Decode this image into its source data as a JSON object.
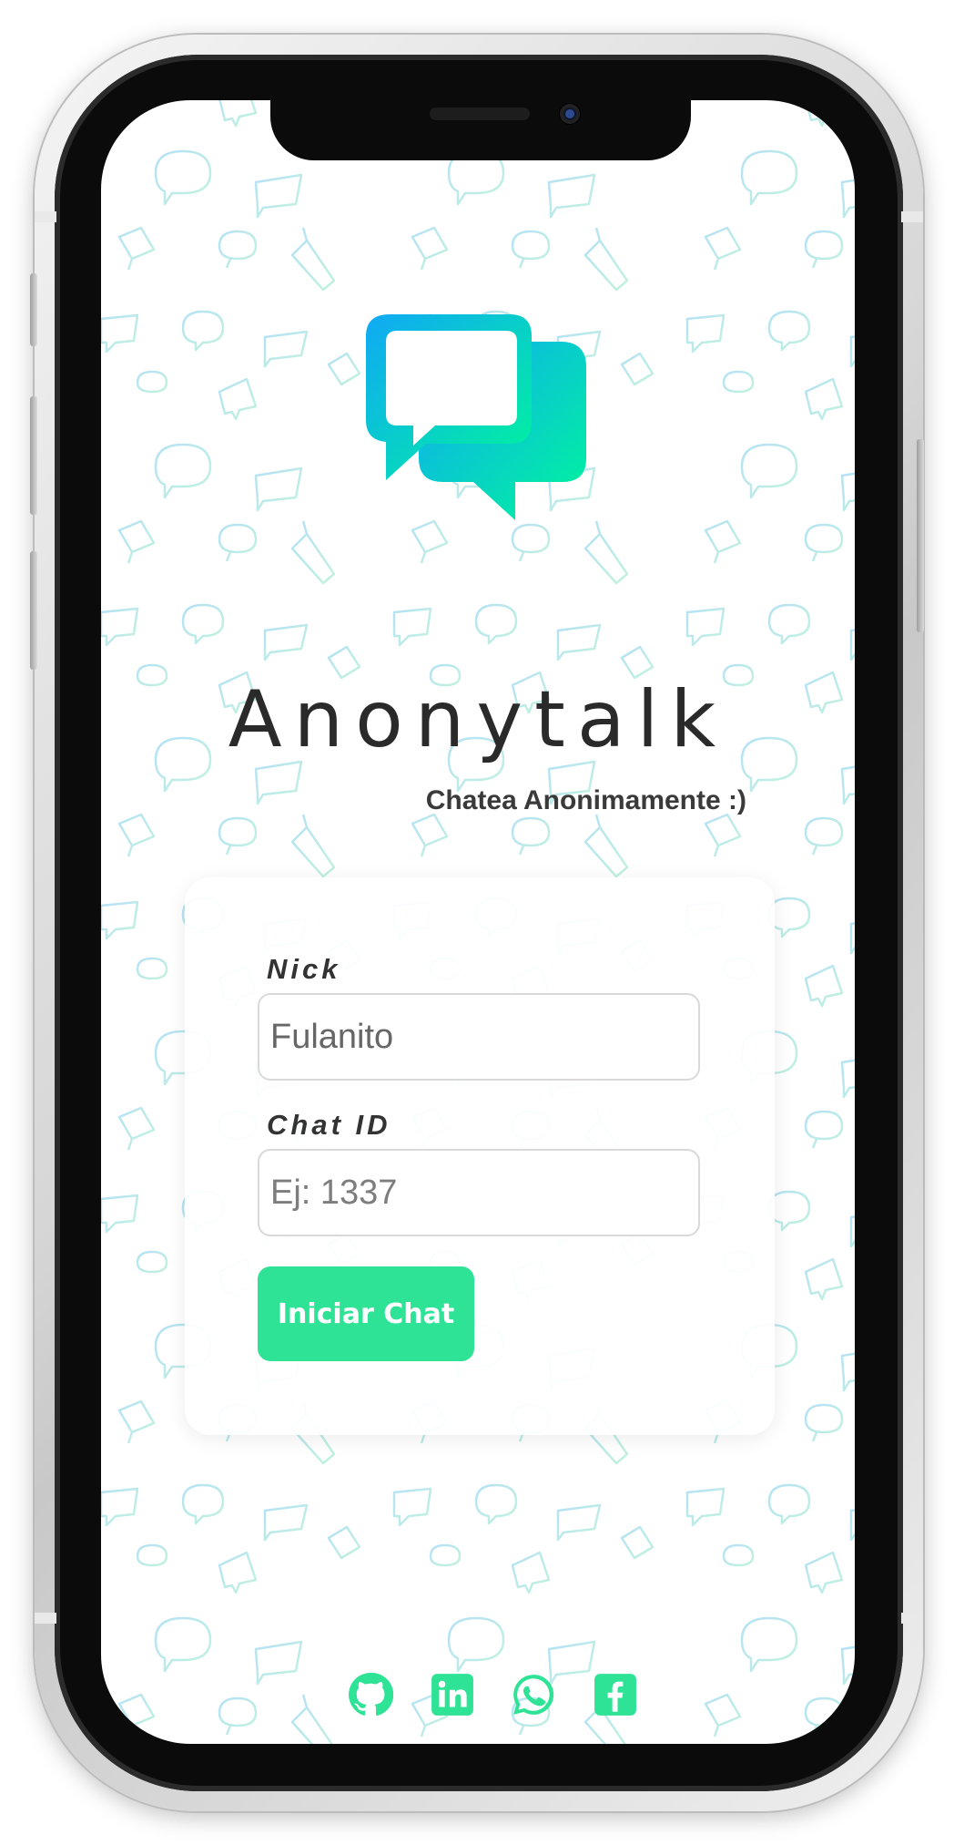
{
  "app": {
    "title": "Anonytalk",
    "subtitle": "Chatea Anonimamente :)"
  },
  "form": {
    "nick_label": "Nick",
    "nick_value": "Fulanito",
    "chat_id_label": "Chat ID",
    "chat_id_placeholder": "Ej: 1337",
    "submit_label": "Iniciar Chat"
  },
  "social": [
    "github-icon",
    "linkedin-icon",
    "whatsapp-icon",
    "facebook-icon"
  ],
  "colors": {
    "accent": "#2fe396",
    "logo_gradient_start": "#10a9f5",
    "logo_gradient_end": "#00f59b",
    "text": "#2a2a2a"
  }
}
